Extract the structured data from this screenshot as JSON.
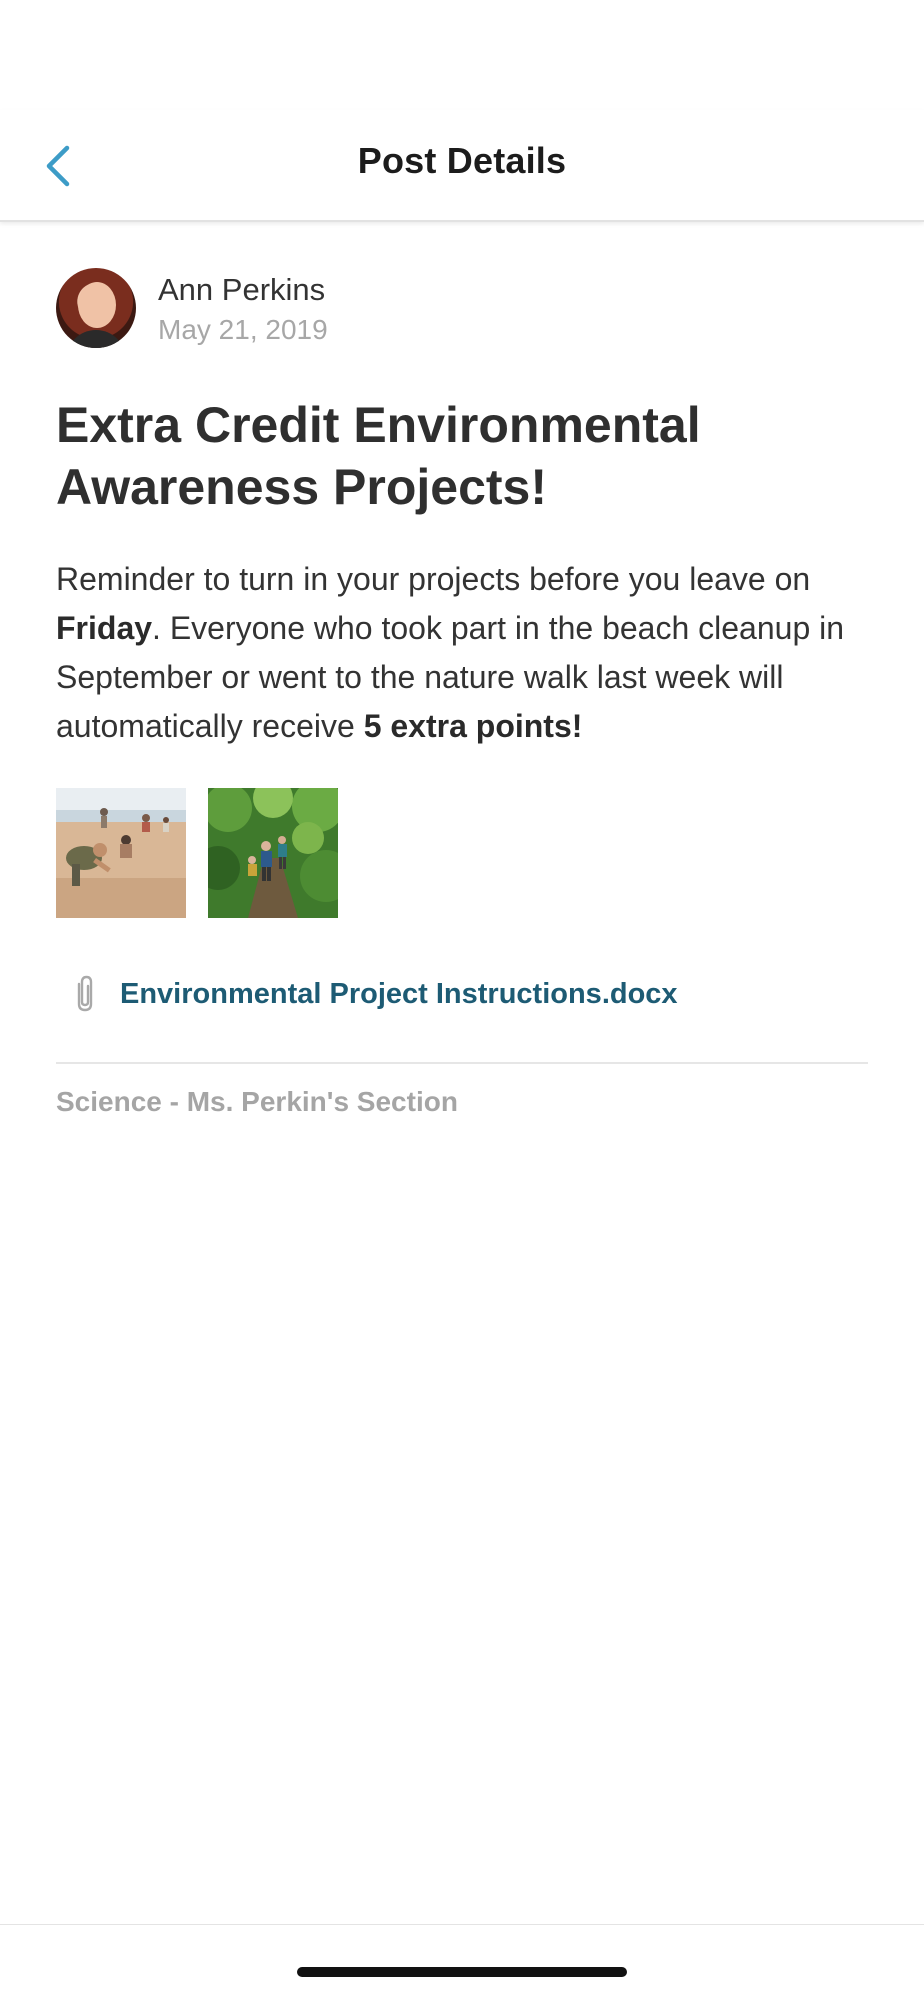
{
  "header": {
    "title": "Post Details",
    "back_icon": "chevron-left-icon",
    "accent_color": "#3d9cc7"
  },
  "post": {
    "author": "Ann Perkins",
    "date": "May 21, 2019",
    "title": "Extra Credit Environmental Awareness Projects!",
    "body": {
      "part1": "Reminder to turn in your projects before you leave on ",
      "bold1": "Friday",
      "part2": ". Everyone who took part in the beach cleanup in September or went to the nature walk  last week will automatically receive ",
      "bold2": "5 extra points!"
    },
    "images": [
      {
        "icon": "beach-cleanup-photo"
      },
      {
        "icon": "nature-walk-photo"
      }
    ],
    "attachment": {
      "icon": "paperclip-icon",
      "filename": "Environmental Project Instructions.docx",
      "color": "#1d5b74"
    },
    "section": "Science - Ms. Perkin's Section"
  }
}
